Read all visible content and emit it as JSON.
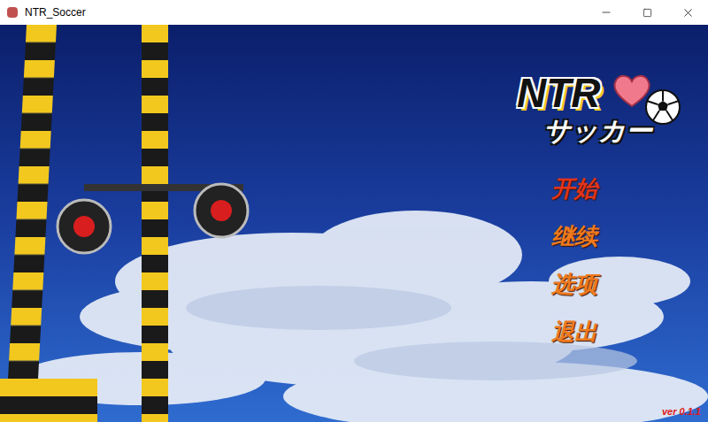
{
  "window": {
    "title": "NTR_Soccer"
  },
  "logo": {
    "line1": "NTR",
    "line2": "サッカー"
  },
  "menu": [
    {
      "label": "开始",
      "selected": true
    },
    {
      "label": "继续",
      "selected": false
    },
    {
      "label": "选项",
      "selected": false
    },
    {
      "label": "退出",
      "selected": false
    }
  ],
  "version": "ver 0.1.1"
}
